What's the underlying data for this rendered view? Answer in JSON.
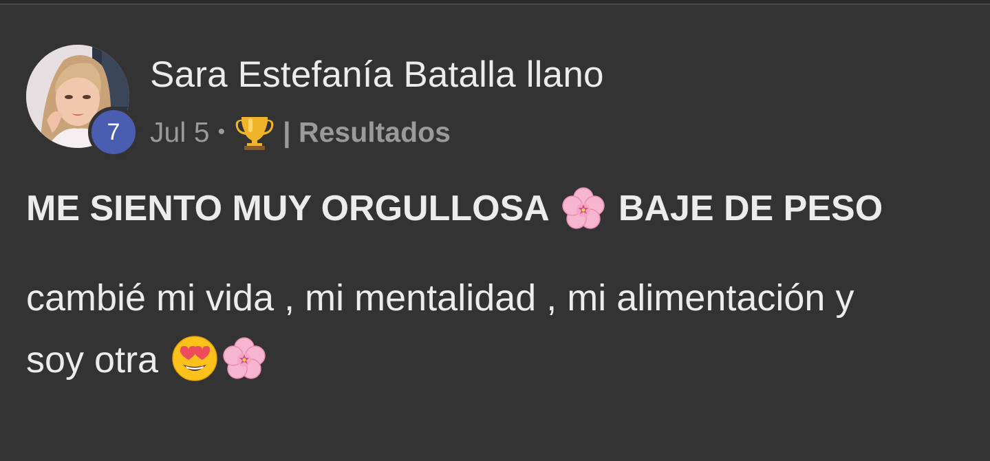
{
  "post": {
    "author": {
      "name": "Sara Estefanía Batalla llano",
      "level": "7"
    },
    "meta": {
      "date": "Jul 5",
      "separator": "•",
      "category_icon": "trophy-icon",
      "category": "| Resultados"
    },
    "title_parts": [
      "ME SIENTO MUY ORGULLOSA",
      "BAJE DE PESO"
    ],
    "title_emoji": "cherry-blossom-icon",
    "body_lines": [
      "cambié mi vida , mi mentalidad , mi alimentación y",
      "soy otra"
    ],
    "body_emojis": [
      "heart-eyes-face-icon",
      "cherry-blossom-icon"
    ]
  },
  "colors": {
    "background": "#333333",
    "text": "#ececec",
    "muted": "#9a9a9a",
    "level_badge": "#4a5db0"
  }
}
